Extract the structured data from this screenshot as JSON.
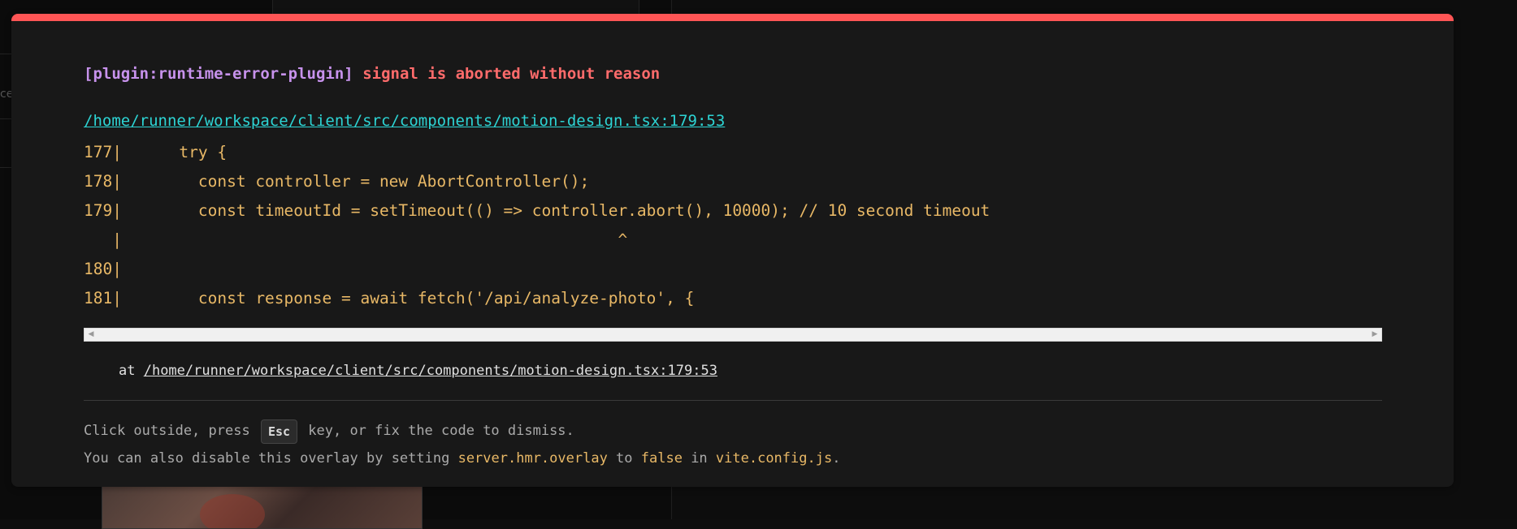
{
  "overlay": {
    "plugin": "[plugin:runtime-error-plugin]",
    "message": "signal is aborted without reason",
    "file_link": "/home/runner/workspace/client/src/components/motion-design.tsx:179:53",
    "code_lines": [
      "177|      try {",
      "178|        const controller = new AbortController();",
      "179|        const timeoutId = setTimeout(() => controller.abort(), 10000); // 10 second timeout",
      "   |                                                    ^",
      "180|",
      "181|        const response = await fetch('/api/analyze-photo', {"
    ],
    "stack_prefix": "at ",
    "stack_link": "/home/runner/workspace/client/src/components/motion-design.tsx:179:53",
    "tip1": {
      "before": "Click outside, press ",
      "key": "Esc",
      "after": " key, or fix the code to dismiss."
    },
    "tip2": {
      "before": "You can also disable this overlay by setting ",
      "setting": "server.hmr.overlay",
      "middle1": " to ",
      "value": "false",
      "middle2": " in ",
      "file": "vite.config.js",
      "end": "."
    }
  },
  "colors": {
    "accent_bar": "#ff5555",
    "plugin": "#c792ec",
    "message": "#ff6b6b",
    "link": "#2dd4d4",
    "code": "#e8b866"
  },
  "icons": {
    "scroll_left": "triangle-left",
    "scroll_right": "triangle-right"
  },
  "background": {
    "edge_text": "ce"
  }
}
